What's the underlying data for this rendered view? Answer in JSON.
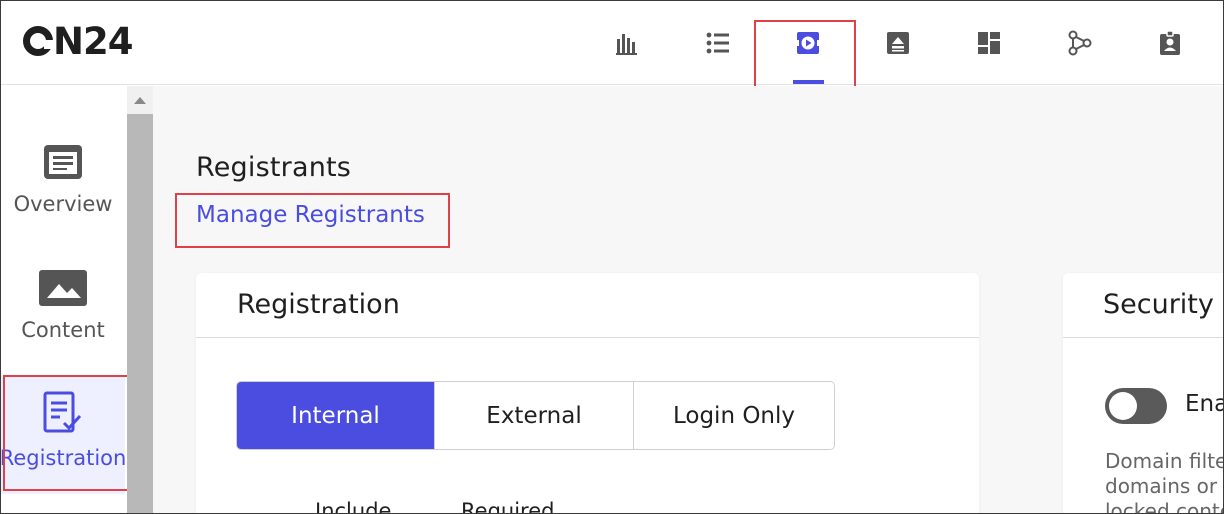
{
  "brand": {
    "logo_text": "N24",
    "accent": "#4a4de0",
    "highlight": "#e04048"
  },
  "topnav": {
    "items": [
      {
        "name": "analytics",
        "icon": "bar-chart-icon"
      },
      {
        "name": "list",
        "icon": "list-icon"
      },
      {
        "name": "console",
        "icon": "console-icon",
        "active": true
      },
      {
        "name": "slides",
        "icon": "slides-icon"
      },
      {
        "name": "layout",
        "icon": "dashboard-icon"
      },
      {
        "name": "network",
        "icon": "network-icon"
      },
      {
        "name": "badge",
        "icon": "badge-icon"
      }
    ]
  },
  "sidebar": {
    "items": [
      {
        "label": "Overview",
        "icon": "overview-icon"
      },
      {
        "label": "Content",
        "icon": "image-icon"
      },
      {
        "label": "Registration",
        "icon": "registration-icon",
        "active": true
      }
    ]
  },
  "main": {
    "section_title": "Registrants",
    "manage_link": "Manage Registrants",
    "registration_card": {
      "title": "Registration",
      "tabs": [
        {
          "label": "Internal",
          "active": true
        },
        {
          "label": "External"
        },
        {
          "label": "Login Only"
        }
      ],
      "columns": [
        "Include",
        "Required"
      ]
    },
    "security_card": {
      "title": "Security",
      "toggle_label": "Ena",
      "description": [
        "Domain filte",
        "domains or s",
        "locked conte"
      ]
    }
  }
}
